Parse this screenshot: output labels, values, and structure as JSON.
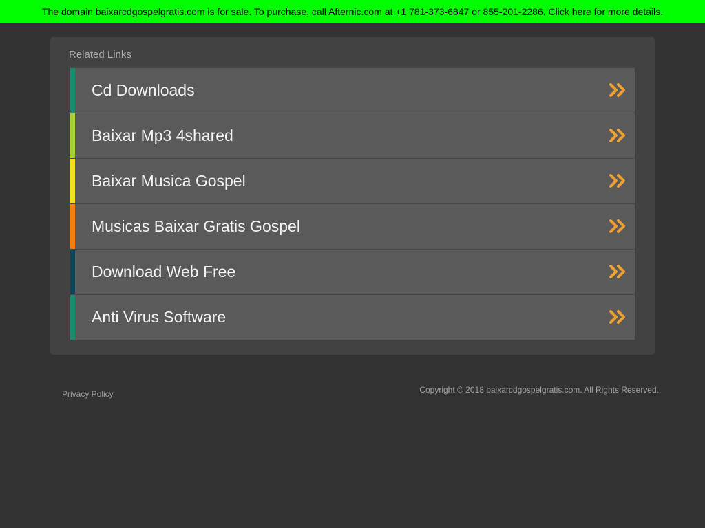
{
  "banner": {
    "text": "The domain baixarcdgospelgratis.com is for sale. To purchase, call Afternic.com at +1 781-373-6847 or 855-201-2286. Click here for more details.",
    "background": "#00ff00"
  },
  "panel": {
    "title": "Related Links",
    "links": [
      {
        "label": "Cd Downloads",
        "accent": "#1e8a6e"
      },
      {
        "label": "Baixar Mp3 4shared",
        "accent": "#a6d13a"
      },
      {
        "label": "Baixar Musica Gospel",
        "accent": "#f5e11c"
      },
      {
        "label": "Musicas Baixar Gratis Gospel",
        "accent": "#f07f12"
      },
      {
        "label": "Download Web Free",
        "accent": "#0b4356"
      },
      {
        "label": "Anti Virus Software",
        "accent": "#1e8a6e"
      }
    ],
    "chevron_icon": "double-chevron-right-icon",
    "chevron_color": "#f0a030"
  },
  "footer": {
    "privacy_label": "Privacy Policy",
    "copyright": "Copyright © 2018 baixarcdgospelgratis.com. All Rights Reserved."
  }
}
